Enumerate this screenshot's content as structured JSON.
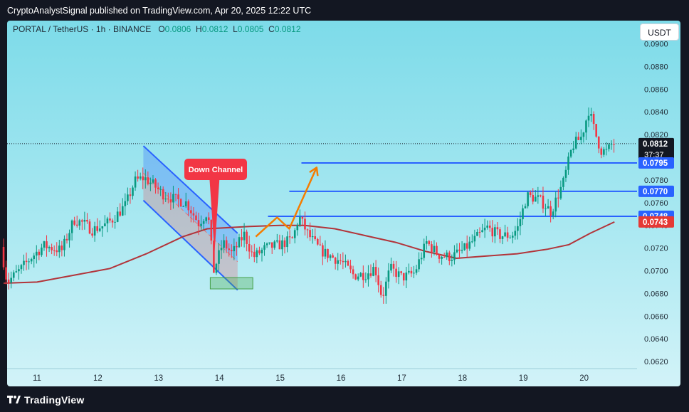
{
  "header": {
    "publisher_line": "CryptoAnalystSignal published on TradingView.com, Apr 20, 2025 12:22 UTC"
  },
  "symbol_bar": {
    "pair": "PORTAL / TetherUS · 1h · BINANCE",
    "open_label": "O",
    "open": "0.0806",
    "high_label": "H",
    "high": "0.0812",
    "low_label": "L",
    "low": "0.0805",
    "close_label": "C",
    "close": "0.0812"
  },
  "currency_button": "USDT",
  "footer": {
    "brand": "TradingView"
  },
  "colors": {
    "bull": "#089981",
    "bear": "#f23645",
    "ma": "#b2343a",
    "level": "#2962ff",
    "arrow": "#f57c00",
    "channel": "#2962ff"
  },
  "chart_data": {
    "type": "candlestick",
    "y_range": [
      0.0614,
      0.0905
    ],
    "y_ticks": [
      "0.0620",
      "0.0640",
      "0.0660",
      "0.0680",
      "0.0700",
      "0.0720",
      "0.0740",
      "0.0760",
      "0.0780",
      "0.0800",
      "0.0820",
      "0.0840",
      "0.0860",
      "0.0880",
      "0.0900"
    ],
    "x_ticks": [
      {
        "label": "11",
        "day": 11
      },
      {
        "label": "12",
        "day": 12
      },
      {
        "label": "13",
        "day": 13
      },
      {
        "label": "14",
        "day": 14
      },
      {
        "label": "15",
        "day": 15
      },
      {
        "label": "16",
        "day": 16
      },
      {
        "label": "17",
        "day": 17
      },
      {
        "label": "18",
        "day": 18
      },
      {
        "label": "19",
        "day": 19
      },
      {
        "label": "20",
        "day": 20
      }
    ],
    "price_anchors": [
      [
        10.45,
        0.0721
      ],
      [
        10.55,
        0.069
      ],
      [
        10.75,
        0.07
      ],
      [
        10.95,
        0.0712
      ],
      [
        11.15,
        0.0722
      ],
      [
        11.45,
        0.0718
      ],
      [
        11.65,
        0.0745
      ],
      [
        11.8,
        0.0742
      ],
      [
        11.95,
        0.0736
      ],
      [
        12.15,
        0.074
      ],
      [
        12.3,
        0.0746
      ],
      [
        12.5,
        0.0758
      ],
      [
        12.65,
        0.0779
      ],
      [
        12.8,
        0.0782
      ],
      [
        12.95,
        0.0776
      ],
      [
        13.1,
        0.0768
      ],
      [
        13.3,
        0.0763
      ],
      [
        13.5,
        0.076
      ],
      [
        13.7,
        0.0742
      ],
      [
        13.85,
        0.0752
      ],
      [
        13.95,
        0.07
      ],
      [
        14.1,
        0.0725
      ],
      [
        14.25,
        0.0715
      ],
      [
        14.45,
        0.0732
      ],
      [
        14.6,
        0.0712
      ],
      [
        14.8,
        0.072
      ],
      [
        15.05,
        0.0723
      ],
      [
        15.25,
        0.0728
      ],
      [
        15.35,
        0.0748
      ],
      [
        15.5,
        0.0732
      ],
      [
        15.7,
        0.0718
      ],
      [
        15.9,
        0.0712
      ],
      [
        16.05,
        0.0708
      ],
      [
        16.25,
        0.0696
      ],
      [
        16.45,
        0.0697
      ],
      [
        16.6,
        0.0703
      ],
      [
        16.72,
        0.0676
      ],
      [
        16.85,
        0.0702
      ],
      [
        17.05,
        0.0694
      ],
      [
        17.25,
        0.0698
      ],
      [
        17.45,
        0.0725
      ],
      [
        17.65,
        0.0714
      ],
      [
        17.85,
        0.0712
      ],
      [
        18.05,
        0.0718
      ],
      [
        18.25,
        0.0728
      ],
      [
        18.45,
        0.0738
      ],
      [
        18.65,
        0.0731
      ],
      [
        18.85,
        0.0731
      ],
      [
        18.95,
        0.0738
      ],
      [
        19.1,
        0.0766
      ],
      [
        19.3,
        0.0763
      ],
      [
        19.5,
        0.0752
      ],
      [
        19.7,
        0.0778
      ],
      [
        19.85,
        0.081
      ],
      [
        20.0,
        0.0818
      ],
      [
        20.12,
        0.0842
      ],
      [
        20.22,
        0.0822
      ],
      [
        20.32,
        0.0806
      ],
      [
        20.42,
        0.0805
      ],
      [
        20.5,
        0.0812
      ]
    ],
    "moving_average": [
      [
        10.45,
        0.0689
      ],
      [
        11.0,
        0.069
      ],
      [
        11.6,
        0.0696
      ],
      [
        12.2,
        0.0702
      ],
      [
        12.8,
        0.0715
      ],
      [
        13.4,
        0.073
      ],
      [
        13.8,
        0.0737
      ],
      [
        14.5,
        0.0739
      ],
      [
        15.0,
        0.074
      ],
      [
        15.4,
        0.074
      ],
      [
        15.9,
        0.0737
      ],
      [
        16.4,
        0.0731
      ],
      [
        16.9,
        0.0725
      ],
      [
        17.4,
        0.0717
      ],
      [
        17.9,
        0.0711
      ],
      [
        18.4,
        0.0713
      ],
      [
        18.9,
        0.0715
      ],
      [
        19.4,
        0.0719
      ],
      [
        19.75,
        0.0723
      ],
      [
        20.1,
        0.0733
      ],
      [
        20.5,
        0.0743
      ]
    ],
    "price_line": "0.0812",
    "countdown": "37:37",
    "levels": [
      {
        "price": 0.0795,
        "label": "0.0795",
        "x_start_day": 15.35
      },
      {
        "price": 0.077,
        "label": "0.0770",
        "x_start_day": 15.15
      },
      {
        "price": 0.0748,
        "label": "0.0748",
        "x_start_day": 14.8
      }
    ],
    "ma_label": "0.0743",
    "down_channel": {
      "label": "Down Channel",
      "upper_start": [
        12.75,
        0.081
      ],
      "upper_end": [
        14.3,
        0.0733
      ],
      "lower_start": [
        12.75,
        0.0762
      ],
      "lower_end": [
        14.3,
        0.0683
      ],
      "pointer_tip": [
        13.92,
        0.0716
      ]
    },
    "target_zone": {
      "from_day": 13.85,
      "to_day": 14.55,
      "low": 0.0684,
      "high": 0.0694
    },
    "projection_path": [
      [
        14.6,
        0.073
      ],
      [
        14.95,
        0.0747
      ],
      [
        15.15,
        0.0737
      ],
      [
        15.6,
        0.0791
      ]
    ]
  }
}
